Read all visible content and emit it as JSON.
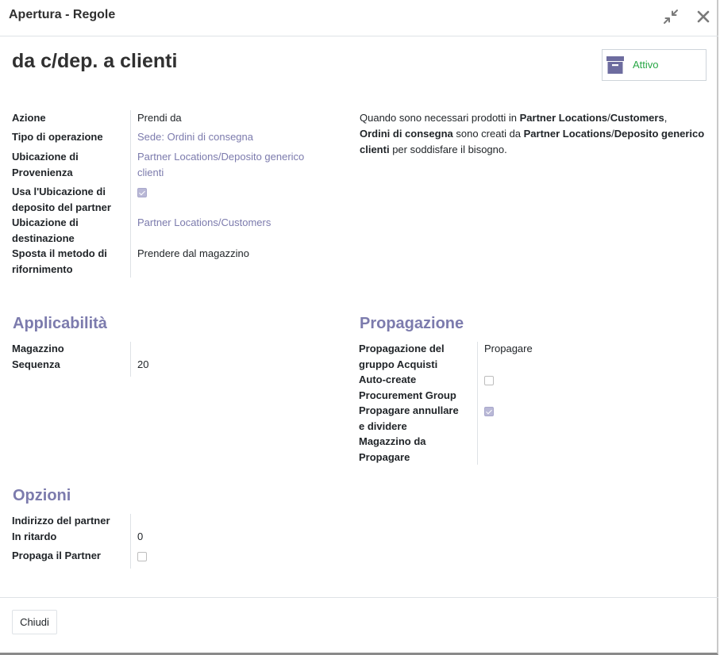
{
  "dialog": {
    "title": "Apertura - Regole"
  },
  "record": {
    "name": "da c/dep. a clienti",
    "active_label": "Attivo"
  },
  "main_fields": {
    "azione": {
      "label": "Azione",
      "value": "Prendi da"
    },
    "tipo_operazione": {
      "label": "Tipo di operazione",
      "value": "Sede: Ordini di consegna"
    },
    "ubicazione_provenienza": {
      "label_line1": "Ubicazione di",
      "label_line2": "Provenienza",
      "value_line1": "Partner Locations/Deposito generico",
      "value_line2": "clienti"
    },
    "usa_ubicazione_deposito": {
      "label_line1": "Usa l'Ubicazione di",
      "label_line2": "deposito del partner",
      "checked": true
    },
    "ubicazione_destinazione": {
      "label_line1": "Ubicazione di",
      "label_line2": "destinazione",
      "value": "Partner Locations/Customers"
    },
    "sposta_metodo": {
      "label_line1": "Sposta il metodo di",
      "label_line2": "rifornimento",
      "value": "Prendere dal magazzino"
    }
  },
  "help_text": {
    "p1": "Quando sono necessari prodotti in ",
    "b1": "Partner Locations",
    "p2": "/",
    "b2": "Customers",
    "p3": ",",
    "b3": "Ordini di consegna",
    "p4": " sono creati da ",
    "b4": "Partner Locations",
    "p5": "/",
    "b5": "Deposito generico clienti",
    "p6": " per soddisfare il bisogno."
  },
  "applicabilita": {
    "title": "Applicabilità",
    "magazzino_label": "Magazzino",
    "magazzino_value": "",
    "sequenza_label": "Sequenza",
    "sequenza_value": "20"
  },
  "propagazione": {
    "title": "Propagazione",
    "gruppo_label_line1": "Propagazione del",
    "gruppo_label_line2": "gruppo Acquisti",
    "gruppo_value": "Propagare",
    "autocreate_label_line1": "Auto-create",
    "autocreate_label_line2": "Procurement Group",
    "autocreate_checked": false,
    "annullare_label_line1": "Propagare annullare",
    "annullare_label_line2": "e dividere",
    "annullare_checked": true,
    "magazzino_label_line1": "Magazzino da",
    "magazzino_label_line2": "Propagare",
    "magazzino_value": ""
  },
  "opzioni": {
    "title": "Opzioni",
    "indirizzo_label": "Indirizzo del partner",
    "indirizzo_value": "",
    "ritardo_label": "In ritardo",
    "ritardo_value": "0",
    "propaga_partner_label": "Propaga il Partner",
    "propaga_partner_checked": false
  },
  "footer": {
    "close_label": "Chiudi"
  },
  "colors": {
    "accent": "#7c7bad",
    "active_green": "#28a745"
  },
  "icons": {
    "minimize": "compress-icon",
    "close": "close-icon",
    "archive": "archive-icon"
  }
}
